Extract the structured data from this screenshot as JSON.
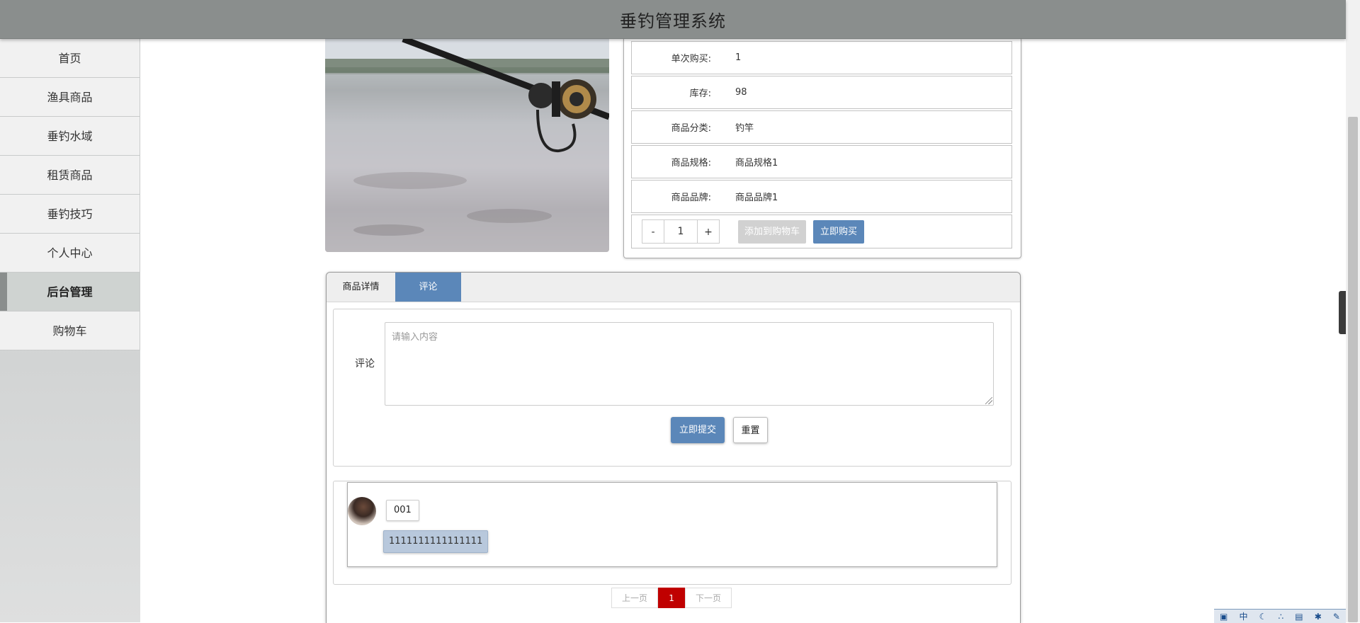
{
  "header": {
    "title": "垂钓管理系统"
  },
  "sidebar": {
    "items": [
      {
        "label": "首页",
        "active": false
      },
      {
        "label": "渔具商品",
        "active": false
      },
      {
        "label": "垂钓水域",
        "active": false
      },
      {
        "label": "租赁商品",
        "active": false
      },
      {
        "label": "垂钓技巧",
        "active": false
      },
      {
        "label": "个人中心",
        "active": false
      },
      {
        "label": "后台管理",
        "active": true
      },
      {
        "label": "购物车",
        "active": false
      }
    ]
  },
  "product": {
    "fields": [
      {
        "label": "单次购买:",
        "value": "1"
      },
      {
        "label": "库存:",
        "value": "98"
      },
      {
        "label": "商品分类:",
        "value": "钓竿"
      },
      {
        "label": "商品规格:",
        "value": "商品规格1"
      },
      {
        "label": "商品品牌:",
        "value": "商品品牌1"
      }
    ],
    "quantity": {
      "minus": "-",
      "value": "1",
      "plus": "+"
    },
    "add_to_cart_label": "添加到购物车",
    "buy_now_label": "立即购买"
  },
  "tabs": [
    {
      "label": "商品详情",
      "active": false
    },
    {
      "label": "评论",
      "active": true
    }
  ],
  "comment_form": {
    "label": "评论",
    "placeholder": "请输入内容",
    "submit_label": "立即提交",
    "reset_label": "重置"
  },
  "comments": [
    {
      "user": "001",
      "text": "1111111111111111"
    }
  ],
  "pager": {
    "prev": "上一页",
    "current": "1",
    "next": "下一页"
  },
  "colors": {
    "accent": "#5b87b9",
    "header_bg": "#8a8e8d",
    "pager_active": "#c00000"
  },
  "icons": {
    "side_toggle": "chevron-left-icon"
  }
}
